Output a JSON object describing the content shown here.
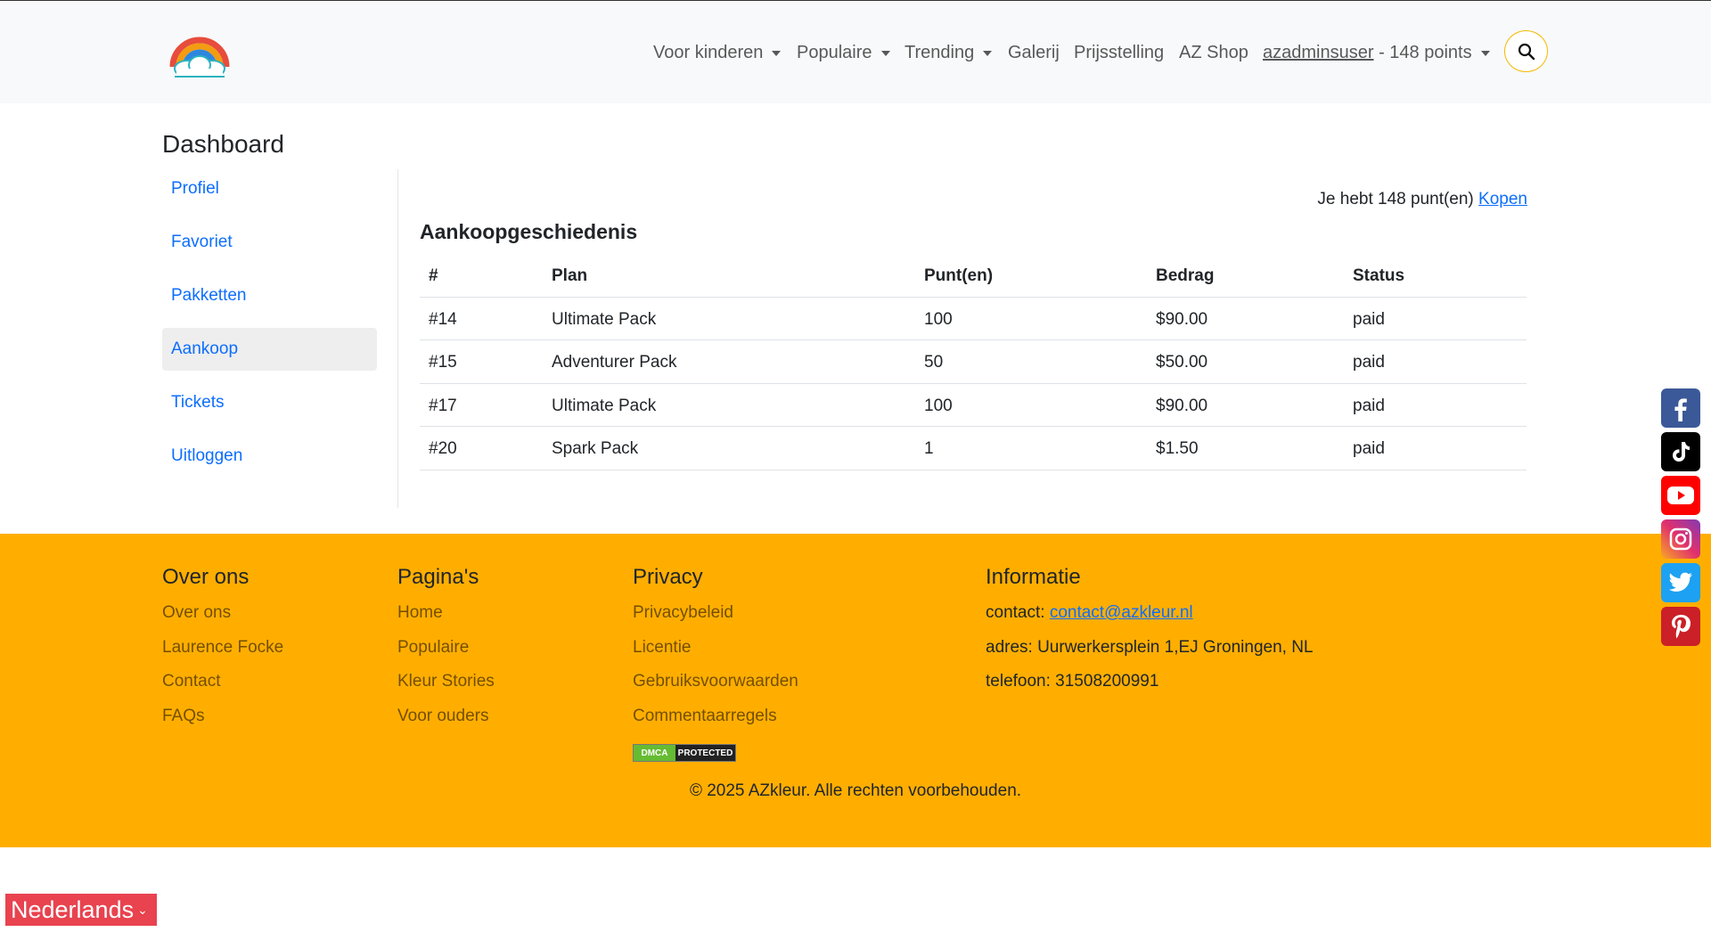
{
  "header": {
    "logo_icon": "rainbow-cloud-icon",
    "nav": [
      {
        "label": "Voor kinderen",
        "dropdown": true
      },
      {
        "label": "Populaire",
        "dropdown": true
      },
      {
        "label": "Trending",
        "dropdown": true
      },
      {
        "label": "Galerij",
        "dropdown": false
      },
      {
        "label": "Prijsstelling",
        "dropdown": false
      },
      {
        "label": "AZ Shop",
        "dropdown": false
      }
    ],
    "user": {
      "name": "azadminsuser",
      "points": " - 148 points"
    },
    "search_icon": "search-icon",
    "accent_color": "#f5b800"
  },
  "dashboard": {
    "title": "Dashboard",
    "menu": [
      {
        "label": "Profiel",
        "active": false
      },
      {
        "label": "Favoriet",
        "active": false
      },
      {
        "label": "Pakketten",
        "active": false
      },
      {
        "label": "Aankoop",
        "active": true
      },
      {
        "label": "Tickets",
        "active": false
      },
      {
        "label": "Uitloggen",
        "active": false
      }
    ],
    "points_text": "Je hebt 148 punt(en) ",
    "buy_label": "Kopen",
    "section_title": "Aankoopgeschiedenis",
    "table": {
      "headers": [
        "#",
        "Plan",
        "Punt(en)",
        "Bedrag",
        "Status"
      ],
      "rows": [
        [
          "#14",
          "Ultimate Pack",
          "100",
          "$90.00",
          "paid"
        ],
        [
          "#15",
          "Adventurer Pack",
          "50",
          "$50.00",
          "paid"
        ],
        [
          "#17",
          "Ultimate Pack",
          "100",
          "$90.00",
          "paid"
        ],
        [
          "#20",
          "Spark Pack",
          "1",
          "$1.50",
          "paid"
        ]
      ]
    }
  },
  "footer": {
    "background_color": "#ffae00",
    "columns": [
      {
        "title": "Over ons",
        "links": [
          "Over ons",
          "Laurence Focke",
          "Contact",
          "FAQs"
        ]
      },
      {
        "title": "Pagina's",
        "links": [
          "Home",
          "Populaire",
          "Kleur Stories",
          "Voor ouders"
        ]
      },
      {
        "title": "Privacy",
        "links": [
          "Privacybeleid",
          "Licentie",
          "Gebruiksvoorwaarden",
          "Commentaarregels"
        ]
      }
    ],
    "info": {
      "title": "Informatie",
      "contact_label": "contact: ",
      "contact_email": "contact@azkleur.nl",
      "address": "adres: Uurwerkersplein 1,EJ Groningen, NL",
      "phone": "telefoon: 31508200991"
    },
    "dmca": {
      "left": "DMCA",
      "right": "PROTECTED"
    },
    "copyright": "© 2025 AZkleur. Alle rechten voorbehouden."
  },
  "social": [
    {
      "icon": "facebook-icon",
      "color": "#3b5998"
    },
    {
      "icon": "tiktok-icon",
      "color": "#000000"
    },
    {
      "icon": "youtube-icon",
      "color": "#ff0000"
    },
    {
      "icon": "instagram-icon",
      "color": "#c13584"
    },
    {
      "icon": "twitter-icon",
      "color": "#1da1f2"
    },
    {
      "icon": "pinterest-icon",
      "color": "#cb2027"
    }
  ],
  "language": {
    "label": "Nederlands",
    "color": "#e8434f"
  }
}
